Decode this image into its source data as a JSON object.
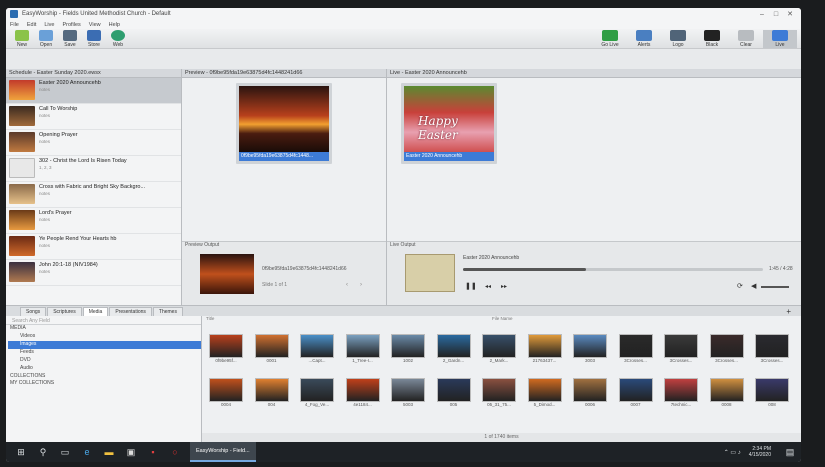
{
  "window": {
    "title": "EasyWorship - Fields United Methodist Church - Default"
  },
  "menu": [
    "File",
    "Edit",
    "Live",
    "Profiles",
    "View",
    "Help"
  ],
  "toolbar": {
    "left": [
      "New",
      "Open",
      "Save",
      "Store",
      "Web"
    ],
    "right": [
      "Go Live",
      "Alerts",
      "Logo",
      "Black",
      "Clear",
      "Live"
    ]
  },
  "schedule": {
    "header": "Schedule - Easter Sunday 2020.ewsx",
    "items": [
      {
        "title": "Easter 2020 Announcehb",
        "sub": "notes"
      },
      {
        "title": "Call To Worship",
        "sub": "notes"
      },
      {
        "title": "Opening Prayer",
        "sub": "notes"
      },
      {
        "title": "302 - Christ the Lord Is Risen Today",
        "sub": "1, 2, 3"
      },
      {
        "title": "Cross with Fabric and Bright Sky Backgro...",
        "sub": "notes"
      },
      {
        "title": "Lord's Prayer",
        "sub": "notes"
      },
      {
        "title": "Ye People Rend Your Hearts hb",
        "sub": "notes"
      },
      {
        "title": "John 20:1-18 (NIV1984)",
        "sub": "notes"
      }
    ]
  },
  "preview": {
    "header": "Preview - 0f9be95fda19e63875d4fc1448241d66",
    "slide_caption": "0f9be95fda19e63875d4fc1448...",
    "output_label": "Preview Output",
    "output_name": "0f9be95fda19e63875d4fc1448241d66",
    "slide_count": "Slide 1 of 1"
  },
  "live": {
    "header": "Live - Easter 2020 Announcehb",
    "slide_caption": "Easter 2020 Announcehb",
    "slide_text": "Happy Easter",
    "output_label": "Live Output",
    "output_name": "Easter 2020 Announcehb",
    "time": "1:45 / 4:28",
    "progress": 0.41
  },
  "tabs": [
    "Songs",
    "Scriptures",
    "Media",
    "Presentations",
    "Themes"
  ],
  "library": {
    "search_placeholder": "Search Any Field",
    "media_label": "MEDIA",
    "nodes": [
      "Videos",
      "Images",
      "Feeds",
      "DVD",
      "Audio"
    ],
    "selected": "Images",
    "collections": "COLLECTIONS",
    "my_collections": "MY COLLECTIONS"
  },
  "media": {
    "col_title": "Title",
    "col_filename": "File Name",
    "row1": [
      "0f9be95f...",
      "0001",
      "...Capt...",
      "1_Tree-I...",
      "1002",
      "2_Gardn...",
      "2_Mark...",
      "21763437...",
      "3003",
      "3Crosses...",
      "3Crosses...",
      "3Crosses...",
      "3Crosses..."
    ],
    "row2": [
      "0004",
      "004",
      "4_Fog_Ve...",
      "4e1184...",
      "5003",
      "005",
      "05_31_75...",
      "5_Dimod...",
      "0006",
      "0007",
      "7technic...",
      "0008",
      "008"
    ],
    "count": "1 of 1740 items"
  },
  "taskbar": {
    "app": "EasyWorship - Field...",
    "time": "2:34 PM",
    "date": "4/15/2020"
  },
  "colors": {
    "selection": "#3d7bd6",
    "taskbar": "#1e2226"
  }
}
